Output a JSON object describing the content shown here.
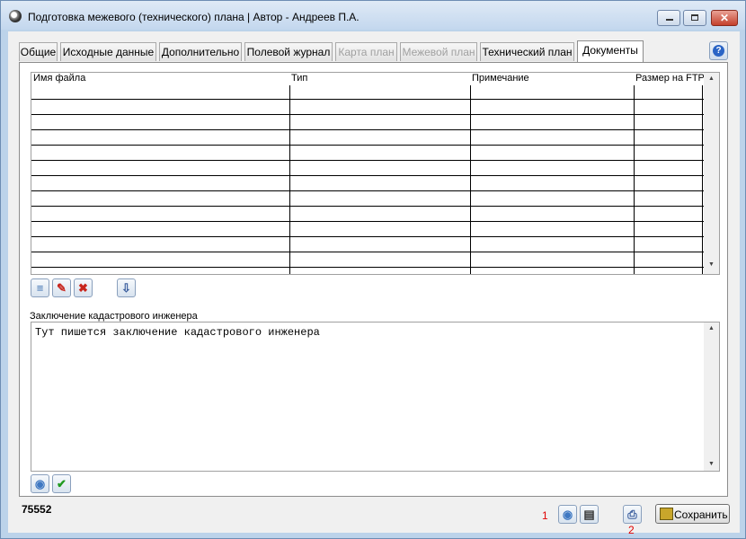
{
  "window": {
    "title": "Подготовка межевого (технического) плана | Автор - Андреев П.А.",
    "close_glyph": "✕"
  },
  "tabs": [
    {
      "label": "Общие",
      "state": "normal"
    },
    {
      "label": "Исходные данные",
      "state": "normal"
    },
    {
      "label": "Дополнительно",
      "state": "normal"
    },
    {
      "label": "Полевой журнал",
      "state": "normal"
    },
    {
      "label": "Карта план",
      "state": "disabled"
    },
    {
      "label": "Межевой план",
      "state": "disabled"
    },
    {
      "label": "Технический план",
      "state": "normal"
    },
    {
      "label": "Документы",
      "state": "active"
    }
  ],
  "help": {
    "glyph": "?"
  },
  "documents_table": {
    "columns": [
      "Имя файла",
      "Тип",
      "Примечание",
      "Размер на FTP"
    ],
    "rows": [
      [
        "",
        "",
        "",
        ""
      ],
      [
        "",
        "",
        "",
        ""
      ],
      [
        "",
        "",
        "",
        ""
      ],
      [
        "",
        "",
        "",
        ""
      ],
      [
        "",
        "",
        "",
        ""
      ],
      [
        "",
        "",
        "",
        ""
      ],
      [
        "",
        "",
        "",
        ""
      ],
      [
        "",
        "",
        "",
        ""
      ],
      [
        "",
        "",
        "",
        ""
      ],
      [
        "",
        "",
        "",
        ""
      ],
      [
        "",
        "",
        "",
        ""
      ],
      [
        "",
        "",
        "",
        ""
      ]
    ],
    "scroll_up": "▲",
    "scroll_down": "▼"
  },
  "table_toolbar": [
    {
      "icon": "document-icon",
      "glyph": "≡"
    },
    {
      "icon": "pencil-icon",
      "glyph": "✎"
    },
    {
      "icon": "delete-icon",
      "glyph": "✖"
    },
    {
      "icon": "export-icon",
      "glyph": "⇩"
    }
  ],
  "conclusion": {
    "label": "Заключение кадастрового инженера",
    "text": "Тут пишется заключение кадастрового инженера"
  },
  "conclusion_toolbar": [
    {
      "icon": "disc-icon",
      "glyph": "◉"
    },
    {
      "icon": "checkmark-icon",
      "glyph": "✔"
    }
  ],
  "footer": {
    "code": "75552",
    "marker_1": "1",
    "marker_2": "2",
    "save_label": "Сохранить",
    "buttons": [
      {
        "icon": "disc-icon",
        "glyph": "◉"
      },
      {
        "icon": "document-icon",
        "glyph": "▤"
      },
      {
        "icon": "print-icon",
        "glyph": "⎙"
      }
    ]
  },
  "colors": {
    "accent": "#2a64c5",
    "delete": "#c8261d",
    "check": "#1f9a1f",
    "marker": "#e00000"
  }
}
